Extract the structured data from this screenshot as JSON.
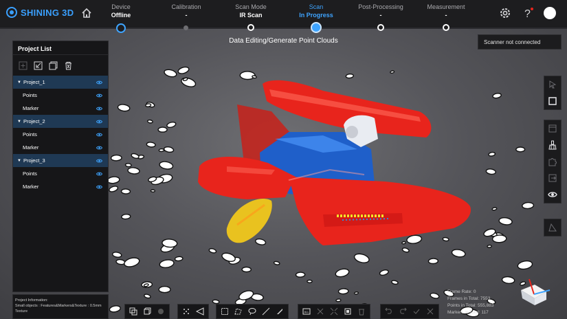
{
  "app": {
    "brand": "SHINING 3D"
  },
  "steps": [
    {
      "label": "Device",
      "value": "Offline",
      "state": "done"
    },
    {
      "label": "Calibration",
      "value": "-",
      "state": "idle"
    },
    {
      "label": "Scan Mode",
      "value": "IR Scan",
      "state": "reached"
    },
    {
      "label": "Scan",
      "value": "In Progress",
      "state": "current"
    },
    {
      "label": "Post-Processing",
      "value": "-",
      "state": "pending"
    },
    {
      "label": "Measurement",
      "value": "-",
      "state": "pending"
    }
  ],
  "mode_title": "Data Editing/Generate Point Clouds",
  "scanner_status": "Scanner not connected",
  "project_panel": {
    "title": "Project List",
    "projects": [
      {
        "name": "Project_1",
        "children": [
          "Points",
          "Marker"
        ]
      },
      {
        "name": "Project_2",
        "children": [
          "Points",
          "Marker"
        ]
      },
      {
        "name": "Project_3",
        "children": [
          "Points",
          "Marker"
        ]
      }
    ]
  },
  "project_info": {
    "heading": "Project Information:",
    "line1": "Small objects : Features&Markers&Texture : 0.5mm",
    "line2": "Texture"
  },
  "stats": {
    "frame_rate": "Frame Rate: 0",
    "frames_total": "Frames in Total: 7553",
    "points_total": "Points in Total: 555,883",
    "markers_total": "Markers in Total: 117"
  },
  "colors": {
    "accent": "#3ea4ff",
    "topbar": "#1d1d1f",
    "panel": "#161618",
    "selected_row": "#1f3954",
    "model_red": "#e8241c",
    "model_blue": "#1f5fc9"
  },
  "icons": {
    "home": "home-icon",
    "settings": "gear-icon",
    "help": "help-icon",
    "eye": "eye-icon"
  }
}
